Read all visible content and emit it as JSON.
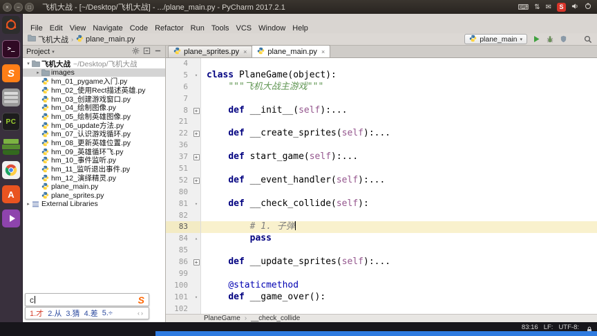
{
  "top_panel": {
    "title": "飞机大战 - [~/Desktop/飞机大战] - .../plane_main.py - PyCharm 2017.2.1",
    "window_buttons": [
      {
        "name": "close-button",
        "glyph": "×"
      },
      {
        "name": "minimize-button",
        "glyph": "−"
      },
      {
        "name": "maximize-button",
        "glyph": "□"
      }
    ],
    "tray_icons": [
      "keyboard-icon",
      "updown-arrows-icon",
      "mail-icon",
      "recorder-badge",
      "volume-icon",
      "power-icon"
    ],
    "recorder_label": "S"
  },
  "launcher": {
    "items": [
      {
        "name": "dash-home",
        "running": false
      },
      {
        "name": "terminal",
        "running": false
      },
      {
        "name": "sogou-pinyin",
        "running": false
      },
      {
        "name": "file-manager",
        "running": false
      },
      {
        "name": "pycharm",
        "running": true
      },
      {
        "name": "docs",
        "running": false
      },
      {
        "name": "chrome",
        "running": false
      },
      {
        "name": "ubuntu-software",
        "running": false
      },
      {
        "name": "media-player",
        "running": false
      }
    ]
  },
  "menu_bar": {
    "items": [
      "File",
      "Edit",
      "View",
      "Navigate",
      "Code",
      "Refactor",
      "Run",
      "Tools",
      "VCS",
      "Window",
      "Help"
    ]
  },
  "nav_bar": {
    "crumbs": [
      {
        "label": "飞机大战",
        "icon": "folder-icon"
      },
      {
        "label": "plane_main.py",
        "icon": "python-file-icon"
      }
    ]
  },
  "run_controls": {
    "config_name": "plane_main",
    "buttons": [
      "run-button",
      "debug-button",
      "coverage-button",
      "search-everywhere-button"
    ]
  },
  "project_panel": {
    "header_label": "Project",
    "header_icons": [
      "settings-icon",
      "collapse-all-icon",
      "hide-icon"
    ],
    "tree": [
      {
        "label": "飞机大战",
        "suffix": "~/Desktop/飞机大战",
        "type": "root",
        "indent": 0,
        "twisty": "open"
      },
      {
        "label": "images",
        "type": "folder",
        "indent": 1,
        "twisty": "closed",
        "selected": true
      },
      {
        "label": "hm_01_pygame入门.py",
        "type": "py",
        "indent": 1
      },
      {
        "label": "hm_02_使用Rect描述英雄.py",
        "type": "py",
        "indent": 1
      },
      {
        "label": "hm_03_创建游戏窗口.py",
        "type": "py",
        "indent": 1
      },
      {
        "label": "hm_04_绘制图像.py",
        "type": "py",
        "indent": 1
      },
      {
        "label": "hm_05_绘制英雄图像.py",
        "type": "py",
        "indent": 1
      },
      {
        "label": "hm_06_update方法.py",
        "type": "py",
        "indent": 1
      },
      {
        "label": "hm_07_认识游戏循环.py",
        "type": "py",
        "indent": 1
      },
      {
        "label": "hm_08_更新英雄位置.py",
        "type": "py",
        "indent": 1
      },
      {
        "label": "hm_09_英雄循环飞.py",
        "type": "py",
        "indent": 1
      },
      {
        "label": "hm_10_事件监听.py",
        "type": "py",
        "indent": 1
      },
      {
        "label": "hm_11_监听退出事件.py",
        "type": "py",
        "indent": 1
      },
      {
        "label": "hm_12_演绎精灵.py",
        "type": "py",
        "indent": 1
      },
      {
        "label": "plane_main.py",
        "type": "py",
        "indent": 1
      },
      {
        "label": "plane_sprites.py",
        "type": "py",
        "indent": 1
      },
      {
        "label": "External Libraries",
        "type": "lib",
        "indent": 0,
        "twisty": "closed"
      }
    ]
  },
  "editor": {
    "tabs": [
      {
        "label": "plane_sprites.py",
        "active": false
      },
      {
        "label": "plane_main.py",
        "active": true
      }
    ],
    "lines": [
      {
        "no": 4,
        "segs": []
      },
      {
        "no": 5,
        "fold": "down",
        "segs": [
          {
            "t": "class",
            "s": "kw"
          },
          {
            "t": " PlaneGame(object):",
            "s": "p"
          }
        ]
      },
      {
        "no": 6,
        "segs": [
          {
            "t": "    ",
            "s": "p"
          },
          {
            "t": "\"\"\"飞机大战主游戏\"\"\"",
            "s": "doc"
          }
        ]
      },
      {
        "no": 7,
        "segs": []
      },
      {
        "no": 8,
        "fold": "plus",
        "segs": [
          {
            "t": "    ",
            "s": "p"
          },
          {
            "t": "def",
            "s": "kw"
          },
          {
            "t": " __init__(",
            "s": "p"
          },
          {
            "t": "self",
            "s": "self"
          },
          {
            "t": "):",
            "s": "p"
          },
          {
            "t": "...",
            "s": "p"
          }
        ]
      },
      {
        "no": 21,
        "segs": []
      },
      {
        "no": 22,
        "fold": "plus",
        "segs": [
          {
            "t": "    ",
            "s": "p"
          },
          {
            "t": "def",
            "s": "kw"
          },
          {
            "t": " __create_sprites(",
            "s": "p"
          },
          {
            "t": "self",
            "s": "self"
          },
          {
            "t": "):",
            "s": "p"
          },
          {
            "t": "...",
            "s": "p"
          }
        ]
      },
      {
        "no": 36,
        "segs": []
      },
      {
        "no": 37,
        "fold": "plus",
        "segs": [
          {
            "t": "    ",
            "s": "p"
          },
          {
            "t": "def",
            "s": "kw"
          },
          {
            "t": " start_game(",
            "s": "p"
          },
          {
            "t": "self",
            "s": "self"
          },
          {
            "t": "):",
            "s": "p"
          },
          {
            "t": "...",
            "s": "p"
          }
        ]
      },
      {
        "no": 51,
        "segs": []
      },
      {
        "no": 52,
        "fold": "plus",
        "segs": [
          {
            "t": "    ",
            "s": "p"
          },
          {
            "t": "def",
            "s": "kw"
          },
          {
            "t": " __event_handler(",
            "s": "p"
          },
          {
            "t": "self",
            "s": "self"
          },
          {
            "t": "):",
            "s": "p"
          },
          {
            "t": "...",
            "s": "p"
          }
        ]
      },
      {
        "no": 80,
        "segs": []
      },
      {
        "no": 81,
        "fold": "down",
        "segs": [
          {
            "t": "    ",
            "s": "p"
          },
          {
            "t": "def",
            "s": "kw"
          },
          {
            "t": " __check_collide(",
            "s": "p"
          },
          {
            "t": "self",
            "s": "self"
          },
          {
            "t": "):",
            "s": "p"
          }
        ]
      },
      {
        "no": 82,
        "segs": []
      },
      {
        "no": 83,
        "current": true,
        "caret": true,
        "segs": [
          {
            "t": "        ",
            "s": "p"
          },
          {
            "t": "# 1. 子弹",
            "s": "cmt"
          }
        ]
      },
      {
        "no": 84,
        "fold": "up",
        "segs": [
          {
            "t": "        ",
            "s": "p"
          },
          {
            "t": "pass",
            "s": "kw"
          }
        ]
      },
      {
        "no": 85,
        "segs": []
      },
      {
        "no": 86,
        "fold": "plus",
        "segs": [
          {
            "t": "    ",
            "s": "p"
          },
          {
            "t": "def",
            "s": "kw"
          },
          {
            "t": " __update_sprites(",
            "s": "p"
          },
          {
            "t": "self",
            "s": "self"
          },
          {
            "t": "):",
            "s": "p"
          },
          {
            "t": "...",
            "s": "p"
          }
        ]
      },
      {
        "no": 99,
        "segs": []
      },
      {
        "no": 100,
        "segs": [
          {
            "t": "    ",
            "s": "p"
          },
          {
            "t": "@staticmethod",
            "s": "dec"
          }
        ]
      },
      {
        "no": 101,
        "fold": "down",
        "segs": [
          {
            "t": "    ",
            "s": "p"
          },
          {
            "t": "def",
            "s": "kw"
          },
          {
            "t": " __game_over():",
            "s": "p"
          }
        ]
      },
      {
        "no": 102,
        "segs": []
      }
    ],
    "breadcrumbs": [
      "PlaneGame",
      "__check_collide"
    ]
  },
  "status_bar": {
    "caret_position": "83:16",
    "line_ending": "LF:",
    "encoding": "UTF-8:"
  },
  "ime": {
    "input": "c",
    "logo": "S",
    "candidates": [
      {
        "index": "1.",
        "text": "才"
      },
      {
        "index": "2.",
        "text": "从"
      },
      {
        "index": "3.",
        "text": "猜"
      },
      {
        "index": "4.",
        "text": "差"
      },
      {
        "index": "5.",
        "text": "÷"
      }
    ],
    "pager": "‹›"
  },
  "colors": {
    "keyword": "#000080",
    "comment": "#808080",
    "docstring": "#629755",
    "current_line": "#f9f1cd",
    "accent_blue": "#2e7be0",
    "recorder_red": "#d8352a"
  }
}
